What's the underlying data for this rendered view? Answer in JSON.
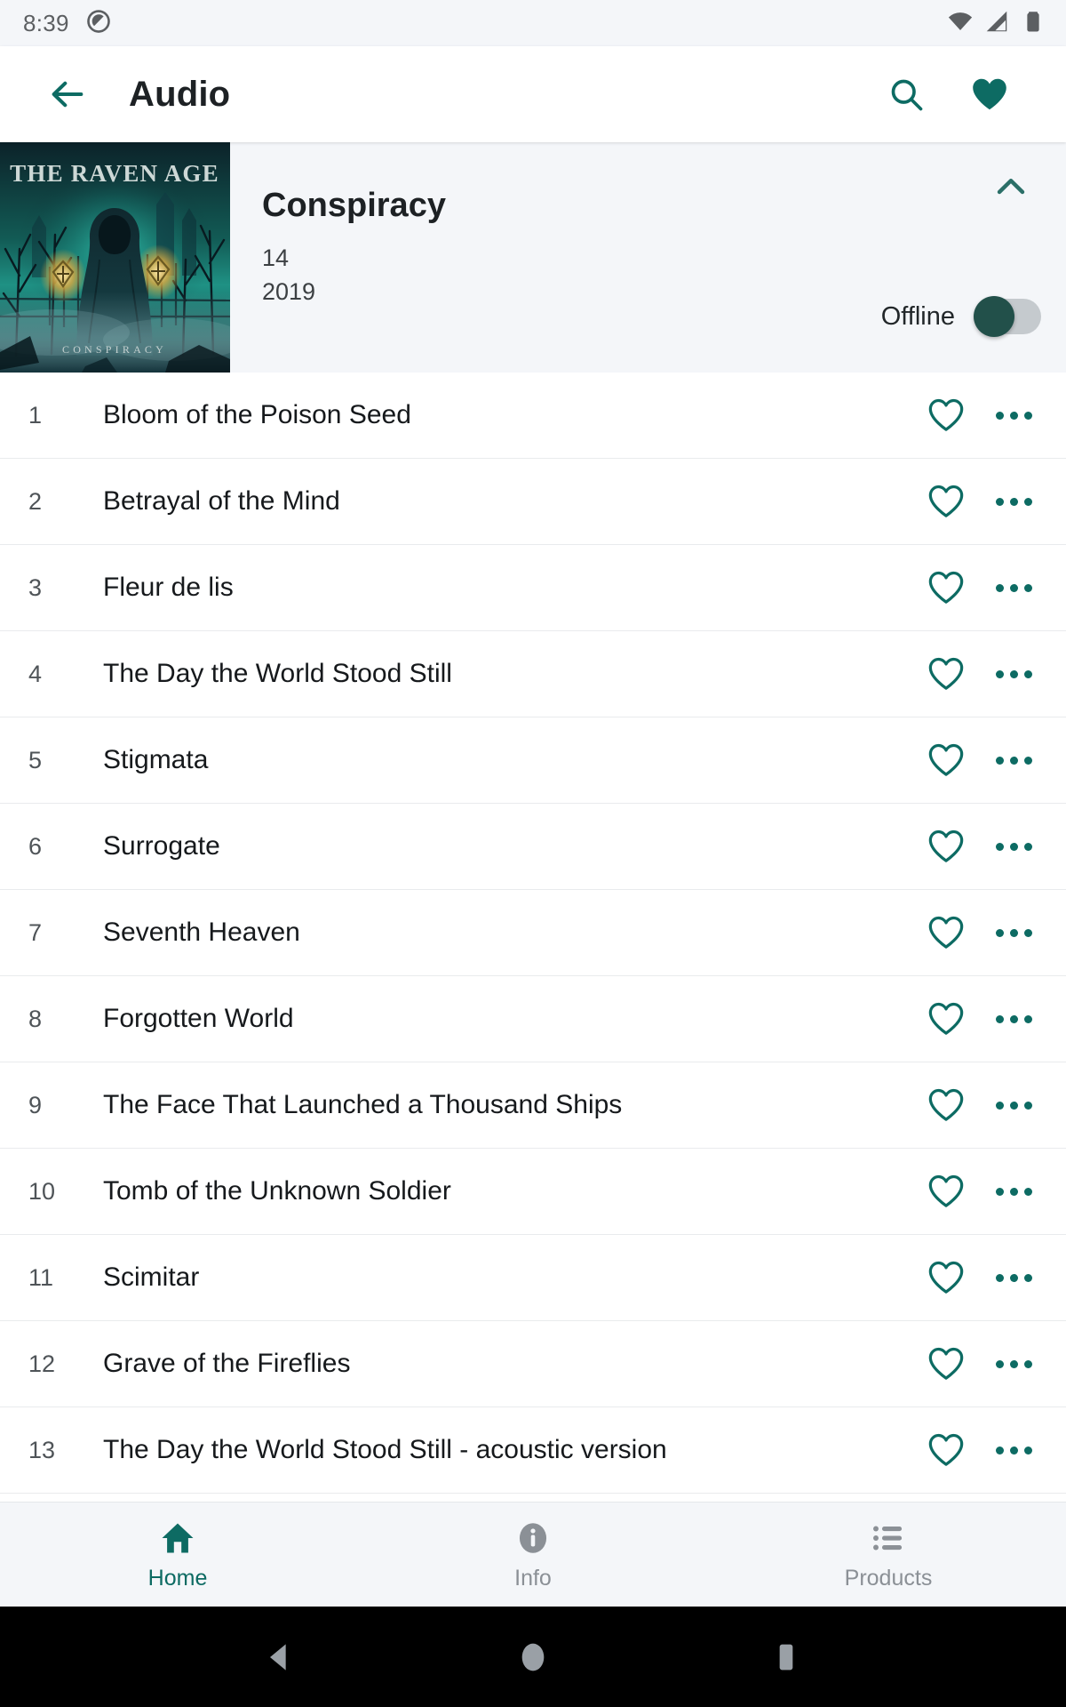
{
  "status_bar": {
    "time": "8:39",
    "icons": [
      "app-circle-icon",
      "wifi-icon",
      "cellular-signal-icon",
      "battery-icon"
    ]
  },
  "app_bar": {
    "back_icon": "back-arrow-icon",
    "title": "Audio",
    "search_icon": "search-icon",
    "favorites_icon": "heart-filled-icon"
  },
  "album": {
    "art_alt": "The Raven Age - Conspiracy album cover",
    "art_band_text": "THE RAVEN AGE",
    "art_title_text": "CONSPIRACY",
    "title": "Conspiracy",
    "track_count": "14",
    "year": "2019",
    "collapse_icon": "chevron-up-icon",
    "offline_label": "Offline",
    "offline_enabled": false
  },
  "tracks": [
    {
      "num": "1",
      "title": "Bloom of the Poison Seed"
    },
    {
      "num": "2",
      "title": "Betrayal of the Mind"
    },
    {
      "num": "3",
      "title": "Fleur de lis"
    },
    {
      "num": "4",
      "title": "The Day the World Stood Still"
    },
    {
      "num": "5",
      "title": "Stigmata"
    },
    {
      "num": "6",
      "title": "Surrogate"
    },
    {
      "num": "7",
      "title": "Seventh Heaven"
    },
    {
      "num": "8",
      "title": "Forgotten World"
    },
    {
      "num": "9",
      "title": "The Face That Launched a Thousand Ships"
    },
    {
      "num": "10",
      "title": "Tomb of the Unknown Soldier"
    },
    {
      "num": "11",
      "title": "Scimitar"
    },
    {
      "num": "12",
      "title": "Grave of the Fireflies"
    },
    {
      "num": "13",
      "title": "The Day the World Stood Still - acoustic version"
    }
  ],
  "track_row_icons": {
    "favorite": "heart-outline-icon",
    "overflow": "more-options-icon"
  },
  "bottom_nav": {
    "items": [
      {
        "label": "Home",
        "icon": "home-icon",
        "active": true
      },
      {
        "label": "Info",
        "icon": "info-icon",
        "active": false
      },
      {
        "label": "Products",
        "icon": "list-icon",
        "active": false
      }
    ]
  },
  "system_nav": {
    "back": "system-back-icon",
    "home": "system-home-icon",
    "recents": "system-recents-icon"
  },
  "colors": {
    "accent_teal": "#0d6b63",
    "toggle_thumb": "#22504a",
    "toggle_track": "#c5cace",
    "header_bg": "#f4f6f9",
    "text_primary": "#16191c",
    "text_muted": "#8b9096"
  }
}
